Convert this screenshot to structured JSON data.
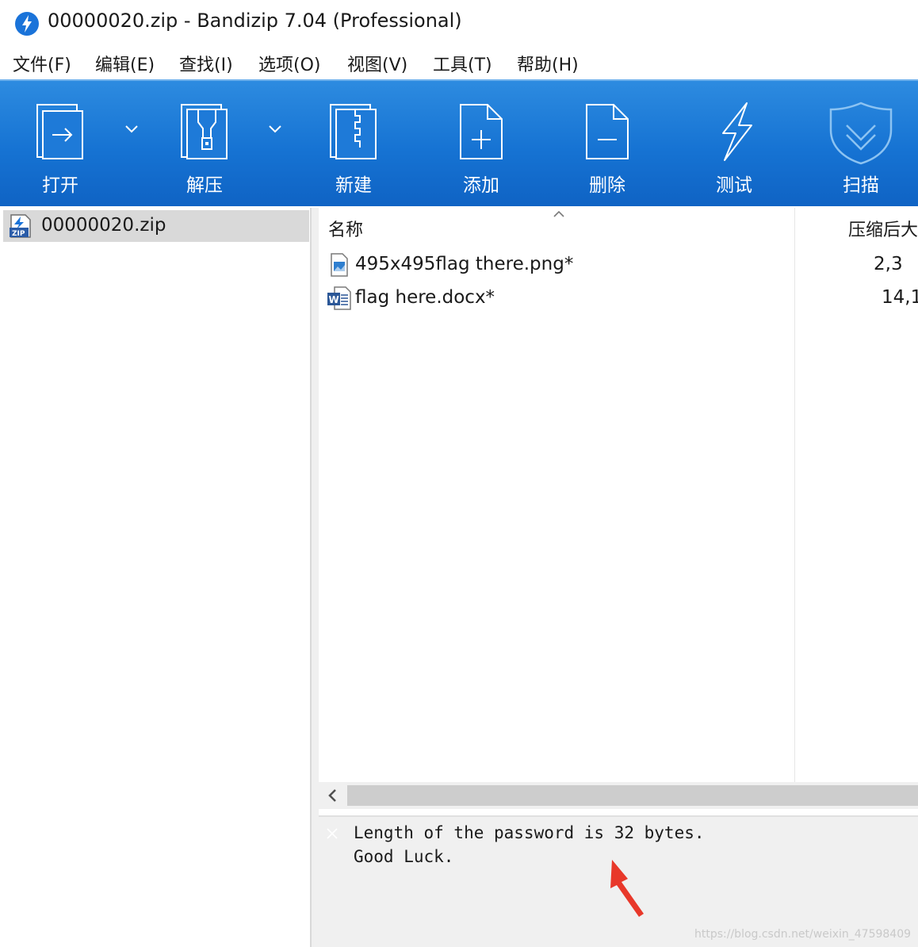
{
  "window": {
    "title": "00000020.zip - Bandizip 7.04 (Professional)"
  },
  "menu": [
    "文件(F)",
    "编辑(E)",
    "查找(I)",
    "选项(O)",
    "视图(V)",
    "工具(T)",
    "帮助(H)"
  ],
  "toolbar": {
    "open_label": "打开",
    "extract_label": "解压",
    "new_label": "新建",
    "add_label": "添加",
    "delete_label": "删除",
    "test_label": "测试",
    "scan_label": "扫描",
    "accent_top": "#2d8be0",
    "accent_bottom": "#0f63c4"
  },
  "tree": {
    "root_label": "00000020.zip"
  },
  "file_list": {
    "columns": {
      "name": "名称",
      "compressed_size": "压缩后大"
    },
    "rows": [
      {
        "name": "495x495flag there.png*",
        "size": "2,3",
        "icon": "image-file-icon"
      },
      {
        "name": "flag here.docx*",
        "size": "14,1",
        "icon": "word-file-icon"
      }
    ]
  },
  "comment": {
    "line1": "Length of the password is 32 bytes.",
    "line2": "Good Luck."
  },
  "watermark": "https://blog.csdn.net/weixin_47598409",
  "colors": {
    "annotation_arrow": "#e8382a"
  }
}
